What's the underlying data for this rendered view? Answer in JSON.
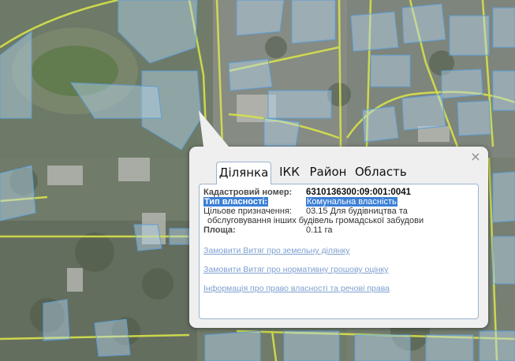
{
  "colors": {
    "parcel_fill": "#b7d7f0",
    "parcel_stroke": "#5e9fd6",
    "road": "#d7e24a",
    "link": "#7d9fd0",
    "selection": "#3b7fd6"
  },
  "popup": {
    "close_symbol": "×",
    "tabs": [
      {
        "label": "Ділянка",
        "active": true
      },
      {
        "label": "ІКК",
        "active": false
      },
      {
        "label": "Район",
        "active": false
      },
      {
        "label": "Область",
        "active": false
      }
    ],
    "fields": {
      "cadastral_label": "Кадастровий номер:",
      "cadastral_value": "6310136300:09:001:0041",
      "ownership_label": "Тип власності:",
      "ownership_value": "Комунальна власність",
      "purpose_label": "Цільове призначення:",
      "purpose_value_line1": "03.15 Для будівництва та",
      "purpose_value_line2": "обслуговування інших будівель громадської забудови",
      "area_label": "Площа:",
      "area_value": "0.11 га"
    },
    "links": [
      "Замовити Витяг про земельну ділянку",
      "Замовити Витяг про нормативну грошову оцінку",
      "Інформація про право власності та речові права"
    ]
  }
}
